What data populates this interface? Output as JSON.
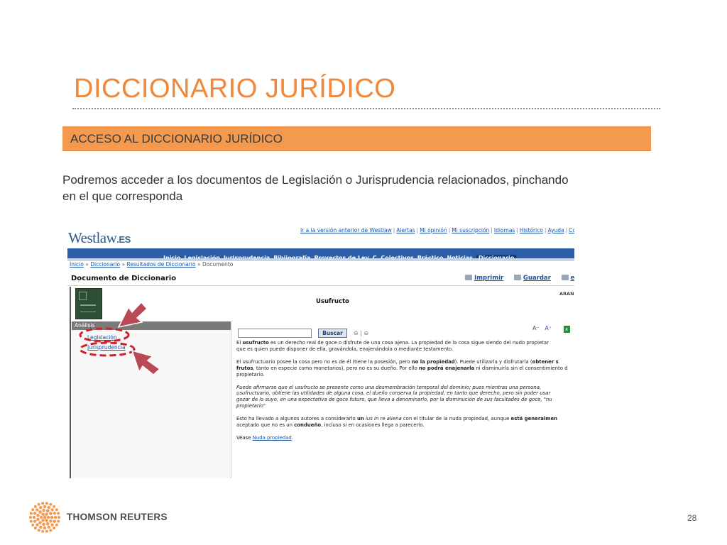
{
  "slide": {
    "title": "DICCIONARIO JURÍDICO",
    "section_heading": "ACCESO AL  DICCIONARIO JURÍDICO",
    "intro_line1": "Podremos acceder a los documentos de Legislación o Jurisprudencia relacionados, pinchando",
    "intro_line2": "en el que corresponda",
    "accent_color": "#f39a4f",
    "title_color": "#f0883b"
  },
  "screenshot": {
    "logo_text": "Westlaw",
    "logo_suffix": ".ES",
    "top_links": [
      "Ir a la versión anterior de Westlaw",
      "Alertas",
      "Mi opinión",
      "Mi suscripción",
      "Idiomas",
      "Histórico",
      "Ayuda",
      "Cobvir"
    ],
    "nav_items": [
      "Inicio",
      "Legislación",
      "Jurisprudencia",
      "Bibliografía",
      "Proyectos de Ley",
      "C. Colectivos",
      "Práctico",
      "Noticias",
      "Diccionario"
    ],
    "active_nav": "Diccionario",
    "breadcrumb": {
      "home": "Inicio",
      "dictionary": "Diccionario",
      "results": "Resultados de Diccionario",
      "current": "Documento",
      "separator": "»"
    },
    "doc_title": "Documento de Diccionario",
    "doc_tools": [
      "Imprimir",
      "Guardar",
      "e-ma"
    ],
    "aran_label": "ARAN",
    "doc_heading": "Usufructo",
    "sidebar": {
      "header": "Análisis",
      "links": [
        "Legislación",
        "Jurisprudencia"
      ]
    },
    "search": {
      "button_label": "Buscar",
      "nav_glyphs": "⊖ | ⊖"
    },
    "font_tools": {
      "smaller": "A⁻",
      "larger": "A⁺",
      "excel_glyph": "x"
    },
    "body_paragraphs": [
      [
        {
          "t": "El ",
          "s": "n"
        },
        {
          "t": "usufructo",
          "s": "b"
        },
        {
          "t": " es un derecho real de goce o disfrute de una cosa ajena. La propiedad de la cosa sigue siendo del nudo propietar",
          "s": "n"
        }
      ],
      [
        {
          "t": "que es quien puede disponer de ella, gravándola, enajenándola o mediante testamento.",
          "s": "n"
        }
      ],
      [
        {
          "t": "El usufructuario posee la cosa pero no es de él (tiene la posesión, pero ",
          "s": "n"
        },
        {
          "t": "no la propiedad",
          "s": "b"
        },
        {
          "t": "). Puede utilizarla y disfrutarla (",
          "s": "n"
        },
        {
          "t": "obtener s",
          "s": "b"
        }
      ],
      [
        {
          "t": "frutos",
          "s": "b"
        },
        {
          "t": ", tanto en especie como monetarios), pero no es su dueño. Por ello ",
          "s": "n"
        },
        {
          "t": "no podrá enajenarla",
          "s": "b"
        },
        {
          "t": " ni disminuirla sin el consentimiento d",
          "s": "n"
        }
      ],
      [
        {
          "t": "propietario.",
          "s": "n"
        }
      ],
      [
        {
          "t": "Puede afirmarse que el usufructo se presente como una desmembración temporal del dominio; pues mientras una persona,",
          "s": "i"
        }
      ],
      [
        {
          "t": "usufructuario, obtiene las utilidades de alguna cosa, el dueño conserva la propiedad, en tanto que derecho, pero sin poder usar",
          "s": "i"
        }
      ],
      [
        {
          "t": "gozar de lo suyo, en una expectativa de goce futuro, que lleva a denominarlo, por la disminución de sus facultades de goce, \"nu",
          "s": "i"
        }
      ],
      [
        {
          "t": "propietario\"",
          "s": "i"
        }
      ],
      [
        {
          "t": "Esto ha llevado a algunos autores a considerarlo ",
          "s": "n"
        },
        {
          "t": "un",
          "s": "b"
        },
        {
          "t": " ",
          "s": "n"
        },
        {
          "t": "ius in re aliena",
          "s": "i"
        },
        {
          "t": " con",
          "s": "n"
        },
        {
          "t": " el titular de la nuda propiedad, aunque ",
          "s": "n"
        },
        {
          "t": "está generalmen",
          "s": "b"
        }
      ],
      [
        {
          "t": "aceptado que no es un ",
          "s": "n"
        },
        {
          "t": "condueño",
          "s": "b"
        },
        {
          "t": ", incluso si en ocasiones llega a parecerlo.",
          "s": "n"
        }
      ],
      [
        {
          "t": "Véase ",
          "s": "n"
        },
        {
          "t": "Nuda propiedad",
          "s": "a"
        },
        {
          "t": ".",
          "s": "n"
        }
      ]
    ],
    "annotation_color": "#d11f2b",
    "arrow_color": "#b94a55"
  },
  "footer": {
    "company": "THOMSON REUTERS",
    "page_number": "28",
    "logo_icon": "thomson-reuters-dot-circle"
  }
}
